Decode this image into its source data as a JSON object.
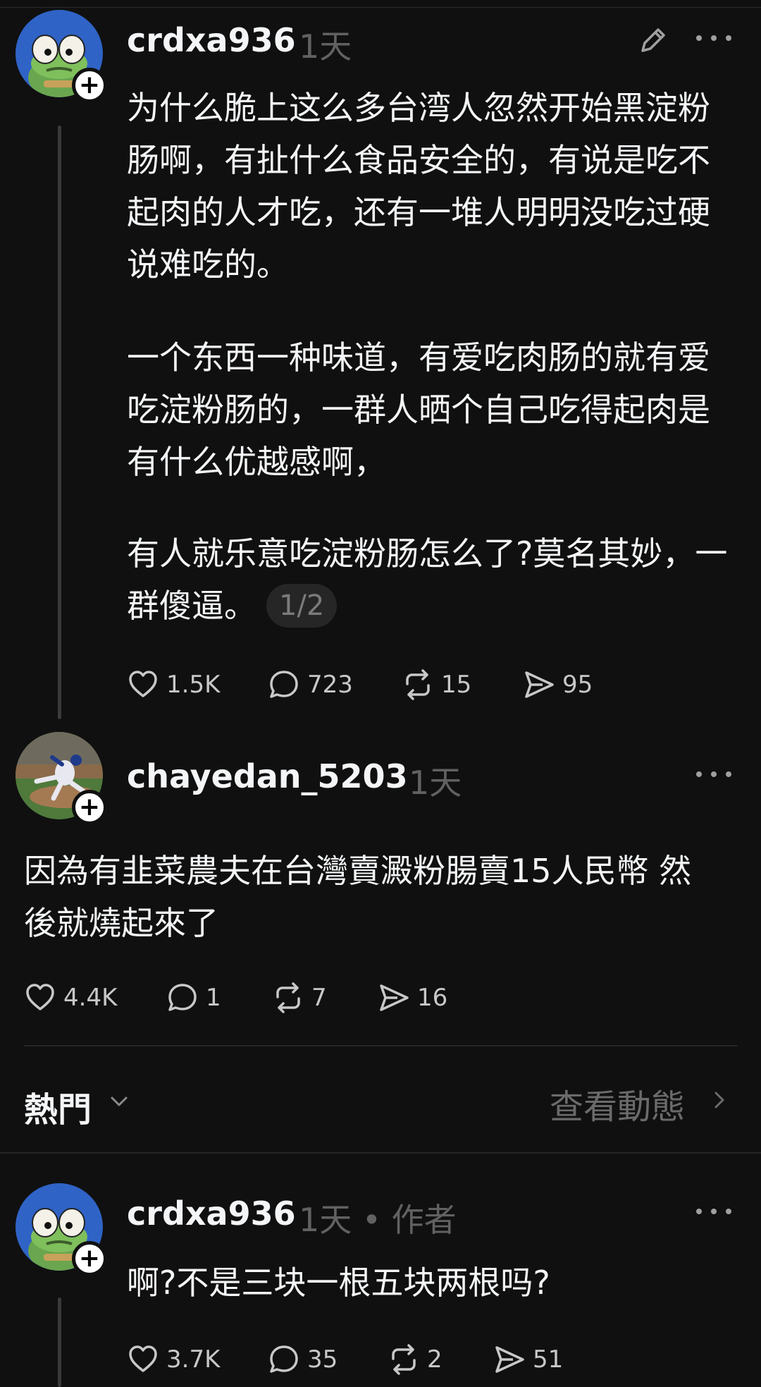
{
  "posts": [
    {
      "username": "crdxa936",
      "time": "1天",
      "paragraphs": [
        "为什么脆上这么多台湾人忽然开始黑淀粉肠啊，有扯什么食品安全的，有说是吃不起肉的人才吃，还有一堆人明明没吃过硬说难吃的。",
        "一个东西一种味道，有爱吃肉肠的就有爱吃淀粉肠的，一群人晒个自己吃得起肉是有什么优越感啊，",
        "有人就乐意吃淀粉肠怎么了?莫名其妙，一群傻逼。"
      ],
      "page_indicator": "1/2",
      "likes": "1.5K",
      "replies": "723",
      "reposts": "15",
      "shares": "95"
    },
    {
      "username": "chayedan_5203",
      "time": "1天",
      "text": "因為有韭菜農夫在台灣賣澱粉腸賣15人民幣 然後就燒起來了",
      "likes": "4.4K",
      "replies": "1",
      "reposts": "7",
      "shares": "16"
    },
    {
      "username": "crdxa936",
      "time": "1天 • 作者",
      "text": "啊?不是三块一根五块两根吗?",
      "likes": "3.7K",
      "replies": "35",
      "reposts": "2",
      "shares": "51"
    }
  ],
  "sort": {
    "label": "熱門",
    "activity_link": "查看動態"
  },
  "icons": {
    "edit": "pencil-icon",
    "more": "more-horizontal-icon",
    "like": "heart-icon",
    "reply": "comment-icon",
    "repost": "repost-icon",
    "share": "send-icon",
    "follow": "plus-icon"
  },
  "colors": {
    "background": "#101010",
    "text": "#f3f5f7",
    "muted": "#616161"
  }
}
